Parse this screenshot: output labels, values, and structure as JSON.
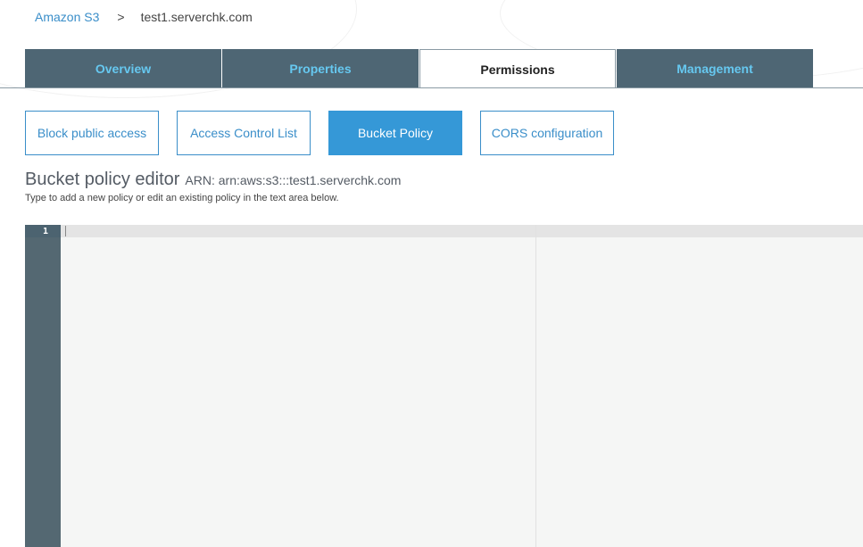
{
  "breadcrumb": {
    "root": "Amazon S3",
    "separator": ">",
    "current": "test1.serverchk.com"
  },
  "tabs": [
    {
      "label": "Overview",
      "active": false
    },
    {
      "label": "Properties",
      "active": false
    },
    {
      "label": "Permissions",
      "active": true
    },
    {
      "label": "Management",
      "active": false
    }
  ],
  "subtabs": [
    {
      "label": "Block public access",
      "active": false
    },
    {
      "label": "Access Control List",
      "active": false
    },
    {
      "label": "Bucket Policy",
      "active": true
    },
    {
      "label": "CORS configuration",
      "active": false
    }
  ],
  "editor": {
    "title": "Bucket policy editor",
    "arn": "ARN: arn:aws:s3:::test1.serverchk.com",
    "subtitle": "Type to add a new policy or edit an existing policy in the text area below.",
    "line_numbers": [
      "1"
    ],
    "content": ""
  },
  "colors": {
    "tab_bg": "#4e6674",
    "tab_text": "#66c8f0",
    "link": "#3a8ec9",
    "subtab_active_bg": "#3598d7",
    "gutter": "#546872"
  }
}
